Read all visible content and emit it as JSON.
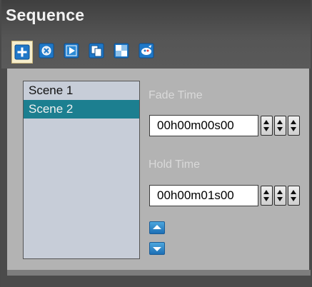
{
  "panel": {
    "title": "Sequence"
  },
  "toolbar": {
    "buttons": [
      {
        "name": "add-icon",
        "active": true
      },
      {
        "name": "remove-icon",
        "active": false
      },
      {
        "name": "play-icon",
        "active": false
      },
      {
        "name": "copy-icon",
        "active": false
      },
      {
        "name": "paste-icon",
        "active": false
      },
      {
        "name": "edit-icon",
        "active": false
      }
    ]
  },
  "scenes": {
    "items": [
      "Scene 1",
      "Scene 2"
    ],
    "selected": "Scene 2"
  },
  "fade": {
    "label": "Fade Time",
    "value": "00h00m00s00"
  },
  "hold": {
    "label": "Hold Time",
    "value": "00h00m01s00"
  },
  "colors": {
    "selection": "#1c7f90",
    "panel_bg": "#b3b3b3",
    "header_bg": "#4b4b4b",
    "icon_blue": "#1f78c8"
  }
}
